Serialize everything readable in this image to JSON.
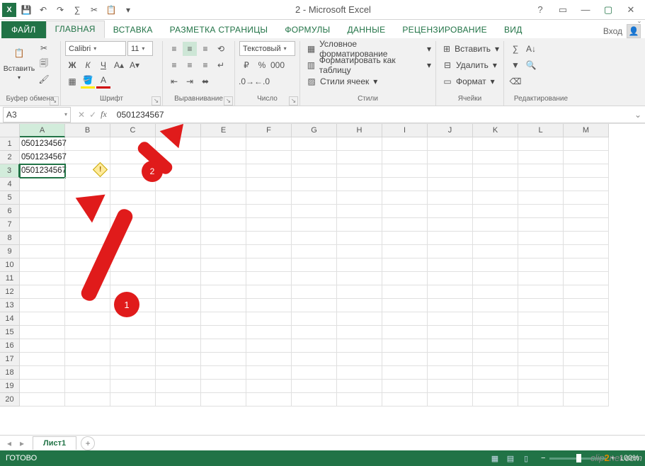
{
  "window": {
    "title": "2 - Microsoft Excel"
  },
  "qat": {
    "save": "💾",
    "undo": "↶",
    "redo": "↷",
    "sum": "∑",
    "cut": "✂",
    "paste": "📋"
  },
  "tabs": {
    "file": "ФАЙЛ",
    "items": [
      "ГЛАВНАЯ",
      "ВСТАВКА",
      "РАЗМЕТКА СТРАНИЦЫ",
      "ФОРМУЛЫ",
      "ДАННЫЕ",
      "РЕЦЕНЗИРОВАНИЕ",
      "ВИД"
    ],
    "active_index": 0,
    "signin": "Вход"
  },
  "ribbon": {
    "clipboard": {
      "label": "Буфер обмена",
      "paste": "Вставить"
    },
    "font": {
      "label": "Шрифт",
      "family": "Calibri",
      "size": "11",
      "bold": "Ж",
      "italic": "К",
      "underline": "Ч"
    },
    "alignment": {
      "label": "Выравнивание"
    },
    "number": {
      "label": "Число",
      "format": "Текстовый"
    },
    "styles": {
      "label": "Стили",
      "conditional": "Условное форматирование",
      "table": "Форматировать как таблицу",
      "cell": "Стили ячеек"
    },
    "cells": {
      "label": "Ячейки",
      "insert": "Вставить",
      "delete": "Удалить",
      "format": "Формат"
    },
    "editing": {
      "label": "Редактирование"
    }
  },
  "formula_bar": {
    "name_box": "A3",
    "formula": "0501234567"
  },
  "grid": {
    "columns": [
      "A",
      "B",
      "C",
      "D",
      "E",
      "F",
      "G",
      "H",
      "I",
      "J",
      "K",
      "L",
      "M"
    ],
    "rows": 20,
    "active_col": "A",
    "active_row": 3,
    "cells": {
      "A1": "0501234567",
      "A2": "0501234567",
      "A3": "0501234567"
    }
  },
  "sheet": {
    "active": "Лист1"
  },
  "status": {
    "ready": "ГОТОВО",
    "zoom": "100%"
  },
  "annotations": {
    "label1": "1",
    "label2": "2"
  },
  "watermark": {
    "pre": "clip",
    "mid": "2",
    "post": "net",
    "ext": ".com"
  }
}
